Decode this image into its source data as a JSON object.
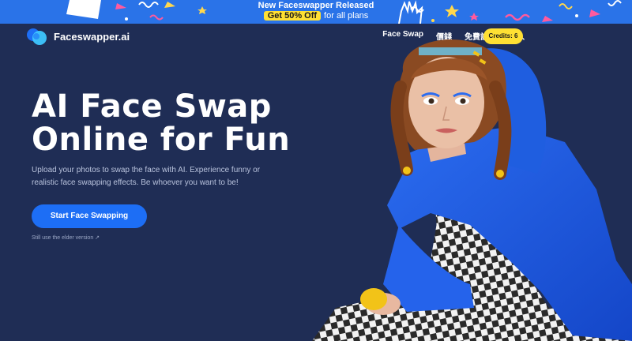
{
  "promo": {
    "line1": "New Faceswapper Released",
    "highlight": "Get 50% Off",
    "line2_rest": "for all plans"
  },
  "nav": {
    "logo_text": "Faceswapper.ai",
    "links": [
      {
        "label": "Face Swap"
      },
      {
        "label": "價錢"
      },
      {
        "label": "免費註冊"
      },
      {
        "label": "登入"
      }
    ],
    "credits_label": "Credits: 6"
  },
  "hero": {
    "title": "AI Face Swap Online for Fun",
    "description": "Upload your photos to swap the face with AI. Experience funny or realistic face swapping effects. Be whoever you want to be!",
    "cta_label": "Start Face Swapping",
    "elder_link": "Still use the elder version ↗"
  },
  "colors": {
    "background": "#1f2d55",
    "banner": "#2a73e8",
    "accent_yellow": "#ffe033",
    "cta_blue": "#1d6ef5"
  },
  "icons": {
    "logo": "faceswapper-logo-icon",
    "external_link": "external-link-icon"
  }
}
